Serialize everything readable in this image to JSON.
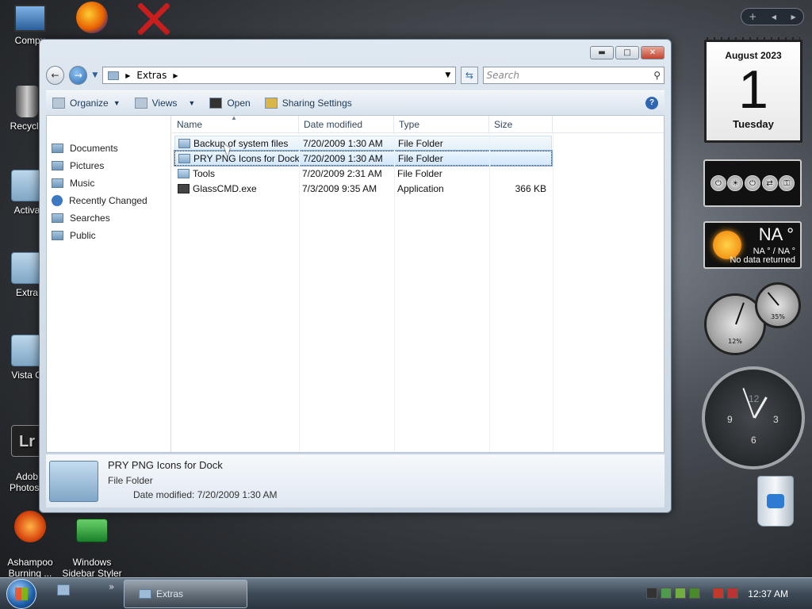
{
  "desktop_icons": [
    {
      "label": "Compu",
      "kind": "monitor-icon"
    },
    {
      "label": "",
      "kind": "firefox-icon"
    },
    {
      "label": "",
      "kind": "red-x-icon"
    },
    {
      "label": "Recycle",
      "kind": "recycle-bin-icon"
    },
    {
      "label": "Activa",
      "kind": "folder-icon"
    },
    {
      "label": "Extra",
      "kind": "folder-icon"
    },
    {
      "label": "Vista O",
      "kind": "folder-icon"
    },
    {
      "label": "Adob\nPhotosh",
      "kind": "photoshop-icon"
    },
    {
      "label": "Ashampoo\nBurning ...",
      "kind": "ashampoo-icon"
    },
    {
      "label": "Windows\nSidebar Styler",
      "kind": "sidebar-styler-icon"
    }
  ],
  "window": {
    "address": {
      "path": [
        "Extras"
      ]
    },
    "search": {
      "placeholder": "Search"
    },
    "toolbar": {
      "organize": "Organize",
      "views": "Views",
      "open": "Open",
      "sharing": "Sharing Settings"
    },
    "nav_pane": [
      {
        "label": "Documents",
        "icon": "folder-icon"
      },
      {
        "label": "Pictures",
        "icon": "folder-icon"
      },
      {
        "label": "Music",
        "icon": "folder-icon"
      },
      {
        "label": "Recently Changed",
        "icon": "search-icon"
      },
      {
        "label": "Searches",
        "icon": "folder-icon"
      },
      {
        "label": "Public",
        "icon": "folder-icon"
      }
    ],
    "columns": {
      "name": "Name",
      "date": "Date modified",
      "type": "Type",
      "size": "Size"
    },
    "files": [
      {
        "name": "Backup of system files",
        "date": "7/20/2009 1:30 AM",
        "type": "File Folder",
        "size": "",
        "icon": "folder-icon"
      },
      {
        "name": "PRY PNG Icons for Dock",
        "date": "7/20/2009 1:30 AM",
        "type": "File Folder",
        "size": "",
        "icon": "folder-icon"
      },
      {
        "name": "Tools",
        "date": "7/20/2009 2:31 AM",
        "type": "File Folder",
        "size": "",
        "icon": "folder-icon"
      },
      {
        "name": "GlassCMD.exe",
        "date": "7/3/2009 9:35 AM",
        "type": "Application",
        "size": "366 KB",
        "icon": "app-icon"
      }
    ],
    "details": {
      "name": "PRY PNG Icons for Dock",
      "type": "File Folder",
      "modified": "Date modified: 7/20/2009 1:30 AM"
    }
  },
  "gadgets": {
    "calendar": {
      "month": "August 2023",
      "day": "1",
      "weekday": "Tuesday"
    },
    "weather": {
      "temp": "NA °",
      "range": "NA ° / NA °",
      "status": "No data returned"
    },
    "cpu": {
      "large_gauge": "12%",
      "small_gauge": "35%"
    },
    "clock": {
      "numerals": [
        "12",
        "3",
        "6",
        "9"
      ]
    }
  },
  "taskbar": {
    "task_label": "Extras",
    "time": "12:37 AM"
  }
}
